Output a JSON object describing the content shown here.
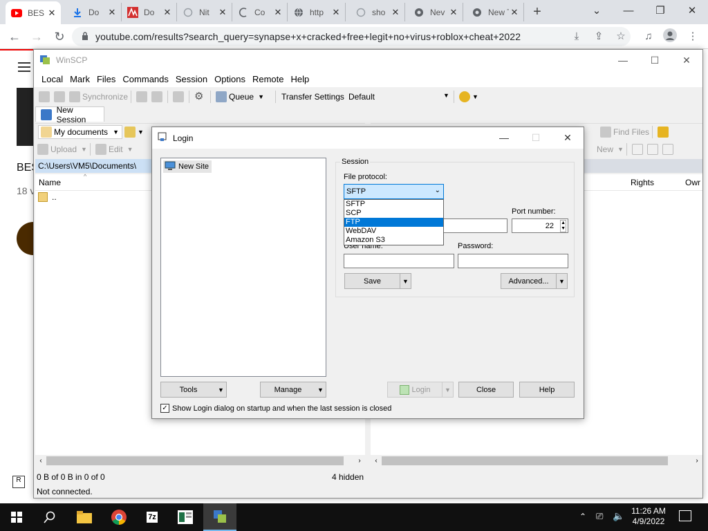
{
  "browser": {
    "tabs": [
      {
        "label": "BES",
        "icon": "youtube-icon",
        "active": true
      },
      {
        "label": "Do",
        "icon": "download-icon"
      },
      {
        "label": "Do",
        "icon": "brand-icon"
      },
      {
        "label": "Nit",
        "icon": "loading-icon"
      },
      {
        "label": "Co",
        "icon": "loading-icon"
      },
      {
        "label": "http",
        "icon": "globe-icon"
      },
      {
        "label": "sho",
        "icon": "loading-icon"
      },
      {
        "label": "Nev",
        "icon": "chrome-icon"
      },
      {
        "label": "New Tal",
        "icon": "chrome-icon"
      }
    ],
    "url": "youtube.com/results?search_query=synapse+x+cracked+free+legit+no+virus+roblox+cheat+2022"
  },
  "youtube_bg": {
    "partial_title": "BES",
    "partial_count": "18 v"
  },
  "winscp": {
    "title": "WinSCP",
    "menu": [
      "Local",
      "Mark",
      "Files",
      "Commands",
      "Session",
      "Options",
      "Remote",
      "Help"
    ],
    "toolbar1": {
      "synchronize": "Synchronize",
      "queue": "Queue",
      "transfer_label": "Transfer Settings",
      "transfer_value": "Default"
    },
    "session_tab": "New Session",
    "local": {
      "folder": "My documents",
      "upload": "Upload",
      "edit": "Edit",
      "path": "C:\\Users\\VM5\\Documents\\",
      "col_name": "Name",
      "parent_row": ".."
    },
    "remote": {
      "find_files": "Find Files",
      "new": "New",
      "col_rights": "Rights",
      "col_owner": "Owr"
    },
    "status": {
      "size_info": "0 B of 0 B in 0 of 0",
      "hidden": "4 hidden",
      "connection": "Not connected."
    }
  },
  "login": {
    "title": "Login",
    "site_tree_item": "New Site",
    "session_group": "Session",
    "file_protocol_label": "File protocol:",
    "file_protocol_value": "SFTP",
    "protocol_options": [
      "SFTP",
      "SCP",
      "FTP",
      "WebDAV",
      "Amazon S3"
    ],
    "protocol_highlighted": "FTP",
    "port_label": "Port number:",
    "port_value": "22",
    "username_label": "User name:",
    "password_label": "Password:",
    "save": "Save",
    "advanced": "Advanced...",
    "tools": "Tools",
    "manage": "Manage",
    "login_btn": "Login",
    "close_btn": "Close",
    "help_btn": "Help",
    "show_dialog_checkbox": "Show Login dialog on startup and when the last session is closed"
  },
  "taskbar": {
    "time": "11:26 AM",
    "date": "4/9/2022"
  }
}
